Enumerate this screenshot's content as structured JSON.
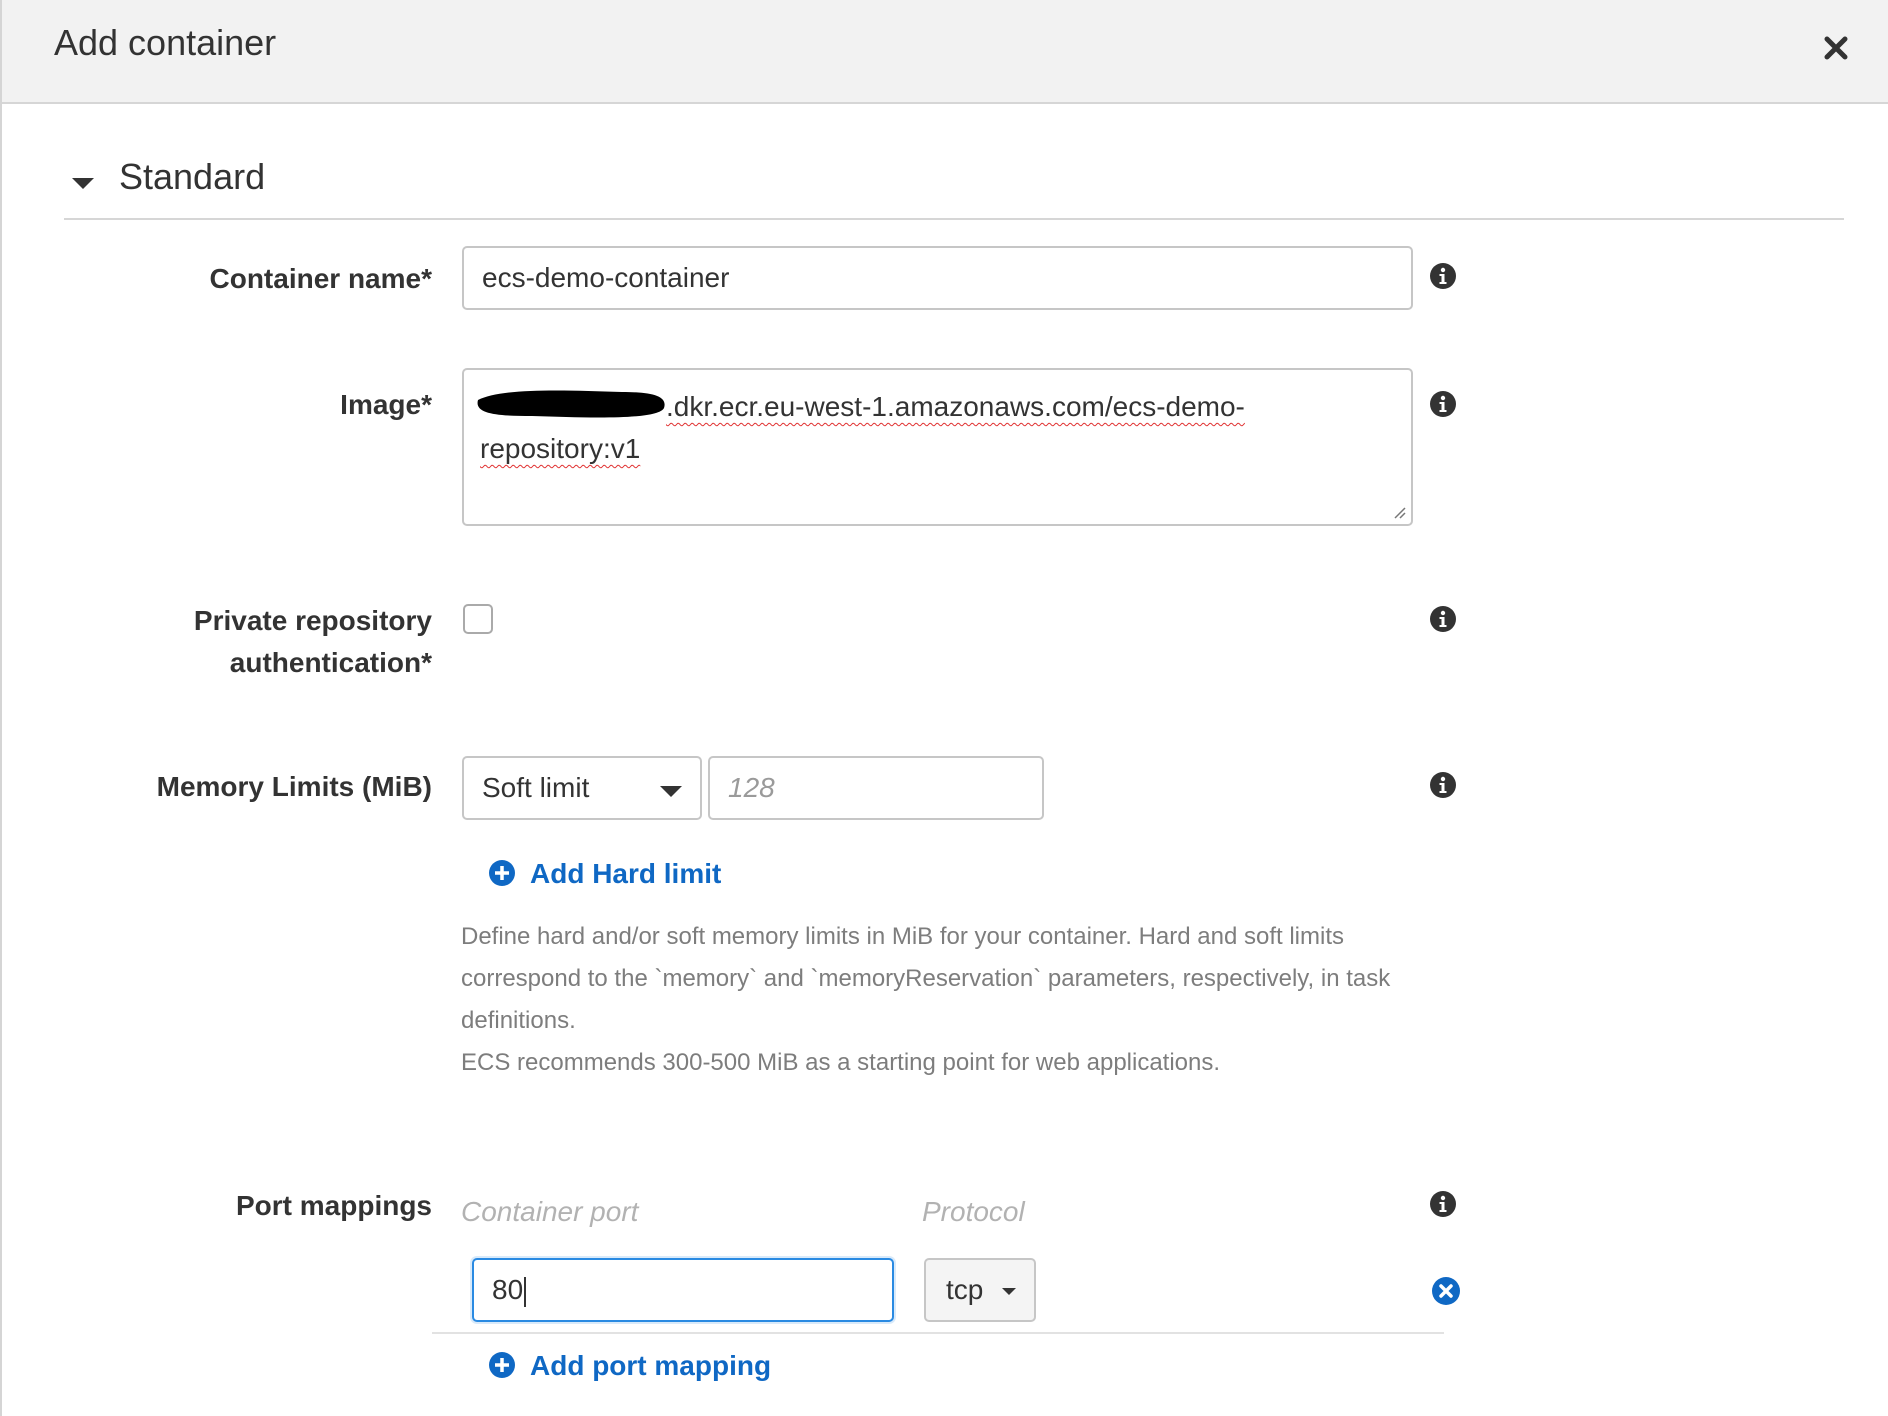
{
  "dialog": {
    "title": "Add container"
  },
  "section": {
    "title": "Standard"
  },
  "fields": {
    "container_name": {
      "label": "Container name*",
      "value": "ecs-demo-container"
    },
    "image": {
      "label": "Image*",
      "value_line1": ".dkr.ecr.eu-west-1.amazonaws.com/ecs-demo-",
      "value_line2": "repository:v1"
    },
    "private_auth": {
      "label_line1": "Private repository",
      "label_line2": "authentication*",
      "checked": false
    },
    "memory": {
      "label": "Memory Limits (MiB)",
      "select_value": "Soft limit",
      "input_placeholder": "128",
      "add_hard_limit": "Add Hard limit",
      "help_line1": "Define hard and/or soft memory limits in MiB for your container. Hard and soft limits",
      "help_line2": "correspond to the `memory` and `memoryReservation` parameters, respectively, in task",
      "help_line3": "definitions.",
      "help_line4": "ECS recommends 300-500 MiB as a starting point for web applications."
    },
    "port_mappings": {
      "label": "Port mappings",
      "col_container_port": "Container port",
      "col_protocol": "Protocol",
      "rows": [
        {
          "container_port": "80",
          "protocol": "tcp"
        }
      ],
      "add_label": "Add port mapping"
    }
  },
  "colors": {
    "link": "#0f68c4",
    "focus": "#2a8ae2",
    "icon": "#333333"
  },
  "icons": [
    "close-icon",
    "caret-down-icon",
    "info-icon",
    "plus-circle-icon",
    "remove-circle-icon"
  ]
}
